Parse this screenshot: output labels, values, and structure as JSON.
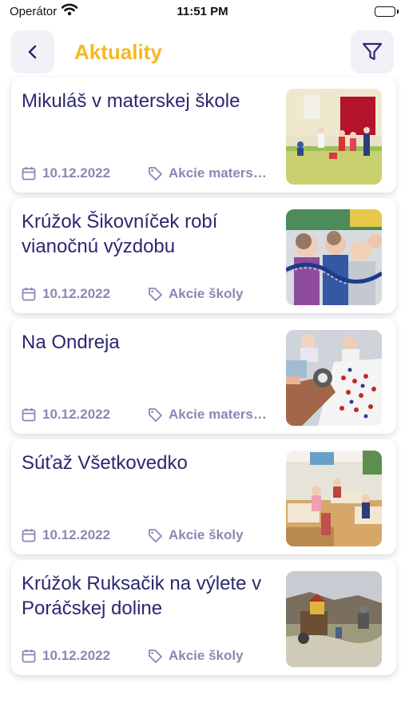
{
  "status_bar": {
    "carrier": "Operátor",
    "time": "11:51 PM"
  },
  "header": {
    "title": "Aktuality",
    "accent_color": "#f5b820"
  },
  "articles": [
    {
      "title": "Mikuláš v materskej škole",
      "date": "10.12.2022",
      "category": "Akcie materskej školy"
    },
    {
      "title": "Krúžok Šikovníček robí vianočnú výzdobu",
      "date": "10.12.2022",
      "category": "Akcie školy"
    },
    {
      "title": "Na Ondreja",
      "date": "10.12.2022",
      "category": "Akcie materskej školy"
    },
    {
      "title": "Súťaž Všetkovedko",
      "date": "10.12.2022",
      "category": "Akcie školy"
    },
    {
      "title": "Krúžok Ruksačik na výlete v Poráčskej doline",
      "date": "10.12.2022",
      "category": "Akcie školy"
    }
  ],
  "colors": {
    "title_text": "#2b2870",
    "meta_text": "#8a88b4",
    "button_bg": "#f2f1f8"
  }
}
